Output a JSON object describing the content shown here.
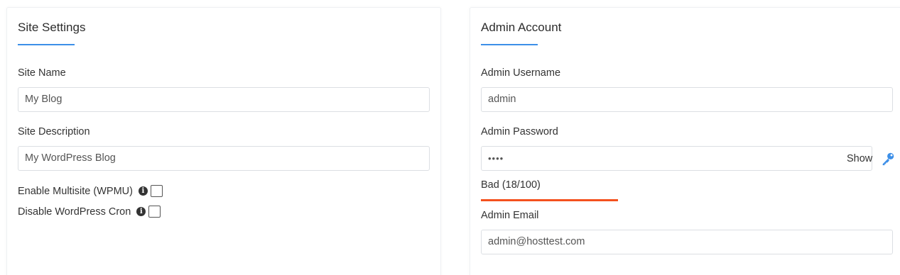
{
  "site_settings": {
    "title": "Site Settings",
    "site_name_label": "Site Name",
    "site_name_value": "My Blog",
    "site_description_label": "Site Description",
    "site_description_value": "My WordPress Blog",
    "multisite_label": "Enable Multisite (WPMU)",
    "multisite_checked": false,
    "disable_cron_label": "Disable WordPress Cron",
    "disable_cron_checked": false
  },
  "admin_account": {
    "title": "Admin Account",
    "username_label": "Admin Username",
    "username_value": "admin",
    "password_label": "Admin Password",
    "password_value": "••••",
    "show_label": "Show",
    "strength_text": "Bad (18/100)",
    "strength_score": 18,
    "email_label": "Admin Email",
    "email_value": "admin@hosttest.com"
  },
  "colors": {
    "accent": "#3d8fe8",
    "strength_bad": "#f4511e"
  },
  "icons": {
    "info": "info-icon",
    "key": "key-icon"
  }
}
